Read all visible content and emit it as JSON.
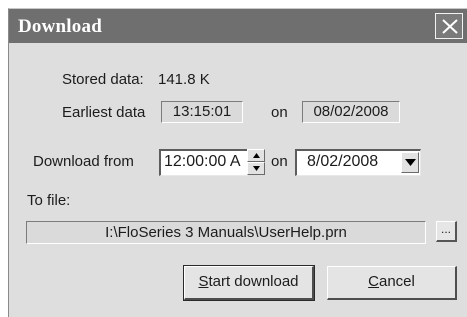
{
  "dialog": {
    "title": "Download"
  },
  "stored_data": {
    "label": "Stored data:",
    "value": "141.8 K"
  },
  "earliest_data": {
    "label": "Earliest data",
    "time": "13:15:01",
    "on_label": "on",
    "date": "08/02/2008"
  },
  "download_from": {
    "label": "Download from",
    "time": "12:00:00 A",
    "on_label": "on",
    "date": "8/02/2008"
  },
  "to_file": {
    "label": "To file:",
    "path": "I:\\FloSeries 3 Manuals\\UserHelp.prn",
    "browse_label": "..."
  },
  "buttons": {
    "start_first": "S",
    "start_rest": "tart download",
    "cancel_first": "C",
    "cancel_rest": "ancel"
  },
  "icons": {
    "close": "close-icon",
    "spin_up": "arrow-up-icon",
    "spin_down": "arrow-down-icon",
    "dropdown": "chevron-down-icon"
  }
}
